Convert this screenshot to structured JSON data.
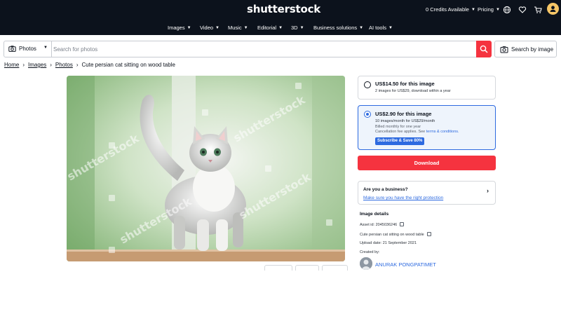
{
  "header": {
    "logo": "shutterstock",
    "credits": "0 Credits Available",
    "pricing": "Pricing",
    "icons": [
      "globe-icon",
      "heart-icon",
      "cart-icon",
      "user-avatar"
    ],
    "nav": [
      "Images",
      "Video",
      "Music",
      "Editorial",
      "3D",
      "Business solutions",
      "AI tools"
    ]
  },
  "search": {
    "type": "Photos",
    "placeholder": "Search for photos",
    "image_search": "Search by image"
  },
  "breadcrumb": {
    "items": [
      "Home",
      "Images",
      "Photos"
    ],
    "current": "Cute persian cat sitting on wood table"
  },
  "photo": {
    "watermark": "shutterstock"
  },
  "options": {
    "single": {
      "title": "US$14.50 for this image",
      "sub": "2 images for US$29, download within a year"
    },
    "subscription": {
      "title": "US$2.90 for this image",
      "line1": "10 images/month for US$29/month",
      "line2": "Billed monthly for one year",
      "line3": "Cancellation fee applies. See",
      "link": "terms & conditions.",
      "badge": "Subscribe & Save 80%"
    }
  },
  "download": "Download",
  "business": {
    "title": "Are you a business?",
    "link": "Make sure you have the right protection"
  },
  "details": {
    "heading": "Image details",
    "asset": "Asset id: 2045036246",
    "caption": "Cute persian cat sitting on wood table",
    "upload": "Upload date: 21 September 2021",
    "created_by": "Created by:",
    "contributor": "ANURAK PONGPATIMET"
  },
  "colors": {
    "header_bg": "#0c121c",
    "accent_red": "#f5333f",
    "link_blue": "#2d6ae0",
    "selected_bg": "#eef4fc"
  }
}
